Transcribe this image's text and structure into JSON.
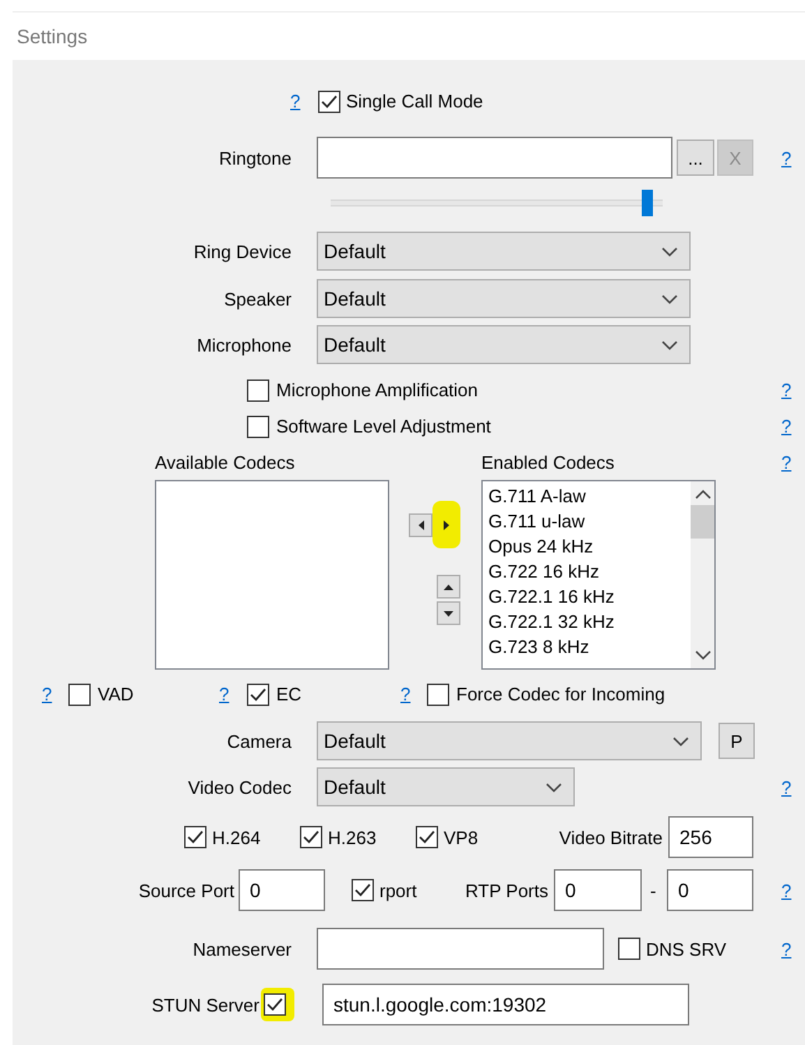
{
  "window": {
    "title": "Settings"
  },
  "single_call_mode": {
    "help": "?",
    "label": "Single Call Mode",
    "checked": true
  },
  "ringtone": {
    "label": "Ringtone",
    "browse": "...",
    "clear": {
      "label": "X",
      "disabled": true
    },
    "help": "?"
  },
  "ringtone_volume": {
    "level": 0.98
  },
  "devices": [
    {
      "label": "Ring Device",
      "value": "Default"
    },
    {
      "label": "Speaker",
      "value": "Default"
    },
    {
      "label": "Microphone",
      "value": "Default"
    }
  ],
  "audio_options": [
    {
      "label": "Microphone Amplification",
      "checked": false,
      "help": "?"
    },
    {
      "label": "Software Level Adjustment",
      "checked": false,
      "help": "?"
    }
  ],
  "codecs": {
    "available_label": "Available Codecs",
    "enabled_label": "Enabled Codecs",
    "help": "?",
    "move_buttons": [
      {
        "kind": "left",
        "highlighted": false
      },
      {
        "kind": "right",
        "highlighted": true
      }
    ],
    "order_buttons": [
      {
        "kind": "up"
      },
      {
        "kind": "down"
      }
    ],
    "enabled": [
      "G.711 A-law",
      "G.711 u-law",
      "Opus 24 kHz",
      "G.722 16 kHz",
      "G.722.1 16 kHz",
      "G.722.1 32 kHz",
      "G.723 8 kHz"
    ]
  },
  "flags": [
    {
      "help": "?",
      "label": "VAD",
      "checked": false
    },
    {
      "help": "?",
      "label": "EC",
      "checked": true
    },
    {
      "help": "?",
      "label": "Force Codec for Incoming",
      "checked": false
    }
  ],
  "camera": {
    "label": "Camera",
    "value": "Default",
    "button": "P"
  },
  "video_codec": {
    "label": "Video Codec",
    "value": "Default",
    "help": "?"
  },
  "video_formats": [
    {
      "label": "H.264",
      "checked": true
    },
    {
      "label": "H.263",
      "checked": true
    },
    {
      "label": "VP8",
      "checked": true
    }
  ],
  "video_bitrate": {
    "label": "Video Bitrate",
    "value": "256"
  },
  "source_port": {
    "label": "Source Port",
    "value": "0"
  },
  "rport": {
    "label": "rport",
    "checked": true
  },
  "rtp_ports": {
    "label": "RTP Ports",
    "from": "0",
    "separator": "-",
    "to": "0",
    "help": "?"
  },
  "nameserver": {
    "label": "Nameserver"
  },
  "dns_srv": {
    "label": "DNS SRV",
    "checked": false,
    "help": "?"
  },
  "stun_server": {
    "label": "STUN Server",
    "checked": true,
    "highlighted": true,
    "value": "stun.l.google.com:19302"
  }
}
